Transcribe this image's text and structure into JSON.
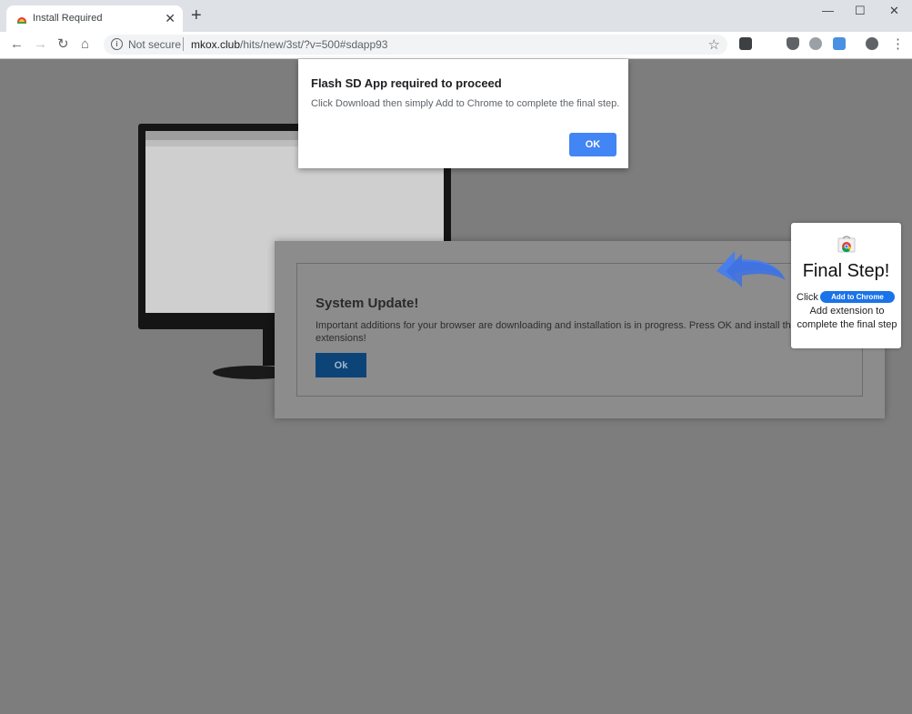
{
  "browser": {
    "tab_title": "Install Required",
    "tab_close": "✕",
    "new_tab": "+",
    "minimize": "—",
    "maximize": "☐",
    "close": "✕",
    "back": "←",
    "forward": "→",
    "reload": "↻",
    "home": "⌂",
    "security_label": "Not secure",
    "url_domain": "mkox.club",
    "url_path": "/hits/new/3st/?v=500#sdapp93",
    "star": "☆",
    "menu": "⋮"
  },
  "dialog": {
    "title": "Flash SD App required to proceed",
    "message": "Click Download then simply Add to Chrome to complete the final step.",
    "ok_label": "OK"
  },
  "system_update": {
    "title": "System Update!",
    "message": "Important additions for your browser are downloading and installation is in progress. Press OK and install the extensions!",
    "ok_label": "Ok"
  },
  "final_step": {
    "title": "Final Step!",
    "click_label": "Click",
    "button_label": "Add to Chrome",
    "description": "Add extension to complete the final step"
  },
  "colors": {
    "chrome_blue": "#4285f4",
    "arrow_blue": "#4a7ee8",
    "overlay_gray": "#7d7d7d"
  }
}
